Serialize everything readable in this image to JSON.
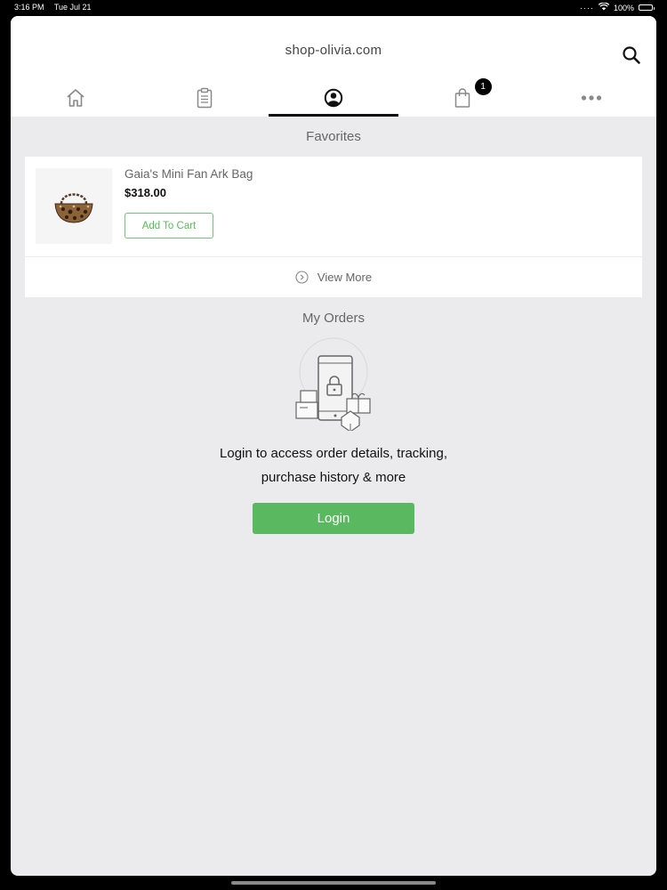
{
  "status_bar": {
    "time": "3:16 PM",
    "date": "Tue Jul 21",
    "dots": "····",
    "battery": "100%"
  },
  "header": {
    "site_title": "shop-olivia.com"
  },
  "tabs": [
    {
      "name": "home",
      "icon": "home-icon"
    },
    {
      "name": "orders",
      "icon": "clipboard-icon"
    },
    {
      "name": "account",
      "icon": "user-circle-icon",
      "active": true
    },
    {
      "name": "cart",
      "icon": "shopping-bag-icon",
      "badge": "1"
    },
    {
      "name": "more",
      "icon": "more-dots-icon"
    }
  ],
  "favorites": {
    "title": "Favorites",
    "items": [
      {
        "name": "Gaia's Mini Fan Ark Bag",
        "price": "$318.00",
        "add_label": "Add To Cart"
      }
    ],
    "view_more_label": "View More"
  },
  "orders": {
    "title": "My Orders",
    "message_line1": "Login to access order details, tracking,",
    "message_line2": "purchase history & more",
    "login_label": "Login"
  },
  "colors": {
    "accent_green": "#5ab960",
    "background": "#ebebed",
    "badge": "#000000"
  }
}
